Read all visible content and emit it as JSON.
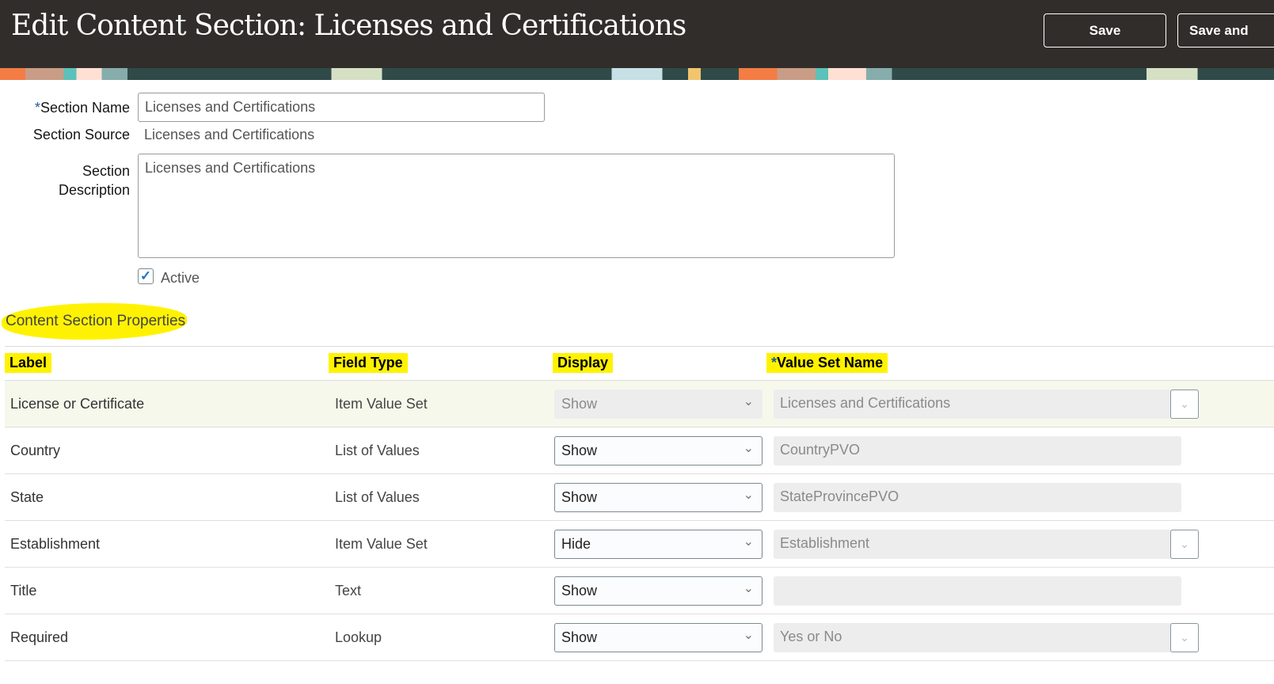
{
  "header": {
    "title": "Edit Content Section: Licenses and Certifications",
    "save": "Save",
    "save_and": "Save and"
  },
  "form": {
    "section_name_label": "Section Name",
    "section_name_value": "Licenses and Certifications",
    "section_source_label": "Section Source",
    "section_source_value": "Licenses and Certifications",
    "desc_label_1": "Section",
    "desc_label_2": "Description",
    "desc_value": "Licenses and Certifications",
    "active_label": "Active",
    "active_checked": true
  },
  "properties": {
    "title": "Content Section Properties",
    "columns": [
      "Label",
      "Field Type",
      "Display",
      "Value Set Name"
    ],
    "rows": [
      {
        "label": "License or Certificate",
        "field_type": "Item Value Set",
        "display": "Show",
        "value_set": "Licenses and Certifications"
      },
      {
        "label": "Country",
        "field_type": "List of Values",
        "display": "Show",
        "value_set": "CountryPVO"
      },
      {
        "label": "State",
        "field_type": "List of Values",
        "display": "Show",
        "value_set": "StateProvincePVO"
      },
      {
        "label": "Establishment",
        "field_type": "Item Value Set",
        "display": "Hide",
        "value_set": "Establishment"
      },
      {
        "label": "Title",
        "field_type": "Text",
        "display": "Show",
        "value_set": ""
      },
      {
        "label": "Required",
        "field_type": "Lookup",
        "display": "Show",
        "value_set": "Yes or No"
      }
    ]
  }
}
